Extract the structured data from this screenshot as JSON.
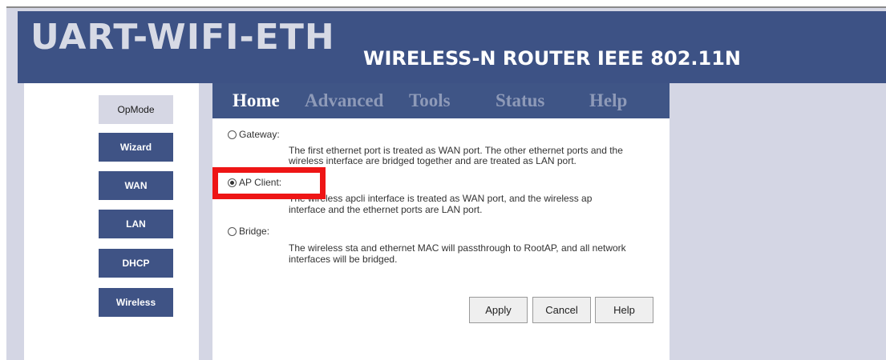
{
  "header": {
    "logo": "UART-WIFI-ETH",
    "subtitle": "WIRELESS-N ROUTER IEEE 802.11N"
  },
  "sidebar": {
    "items": [
      {
        "label": "OpMode",
        "active": true
      },
      {
        "label": "Wizard",
        "active": false
      },
      {
        "label": "WAN",
        "active": false
      },
      {
        "label": "LAN",
        "active": false
      },
      {
        "label": "DHCP",
        "active": false
      },
      {
        "label": "Wireless",
        "active": false
      }
    ]
  },
  "nav": {
    "tabs": [
      "Home",
      "Advanced",
      "Tools",
      "Status",
      "Help"
    ],
    "active": "Home"
  },
  "modes": {
    "gateway": {
      "label": "Gateway:",
      "line1": "The first ethernet port is treated as WAN port. The other ethernet ports and the",
      "line2": "wireless interface are bridged together and are treated as LAN port."
    },
    "ap_client": {
      "label": "AP Client:",
      "line1": "The wireless apcli interface is treated as WAN port, and the wireless ap",
      "line2": "interface and the ethernet ports are LAN port."
    },
    "bridge": {
      "label": "Bridge:",
      "line1": "The wireless sta and ethernet MAC will passthrough to RootAP, and all network",
      "line2": "interfaces will be bridged."
    },
    "selected": "ap_client"
  },
  "buttons": {
    "apply": "Apply",
    "cancel": "Cancel",
    "help": "Help"
  },
  "colors": {
    "header_bg": "#3d5285",
    "nav_bg": "#3f5586",
    "sidebar_button": "#3f5385",
    "highlight": "#ee1515"
  }
}
